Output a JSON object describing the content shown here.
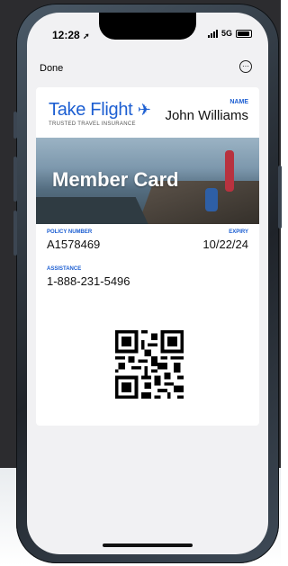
{
  "status": {
    "time": "12:28",
    "network": "5G"
  },
  "nav": {
    "done_label": "Done",
    "more_glyph": "⋯"
  },
  "card": {
    "brand": "Take Flight",
    "tagline": "TRUSTED TRAVEL INSURANCE",
    "name_label": "NAME",
    "name_value": "John Williams",
    "hero_title": "Member Card",
    "policy_label": "POLICY NUMBER",
    "policy_value": "A1578469",
    "expiry_label": "EXPIRY",
    "expiry_value": "10/22/24",
    "assistance_label": "ASSISTANCE",
    "assistance_value": "1-888-231-5496"
  },
  "colors": {
    "brand_blue": "#1d5fd2",
    "screen_bg": "#f1f1f3"
  },
  "icons": [
    "location-arrow-icon",
    "signal-icon",
    "battery-icon",
    "more-icon",
    "plane-icon",
    "qr-code-icon"
  ]
}
